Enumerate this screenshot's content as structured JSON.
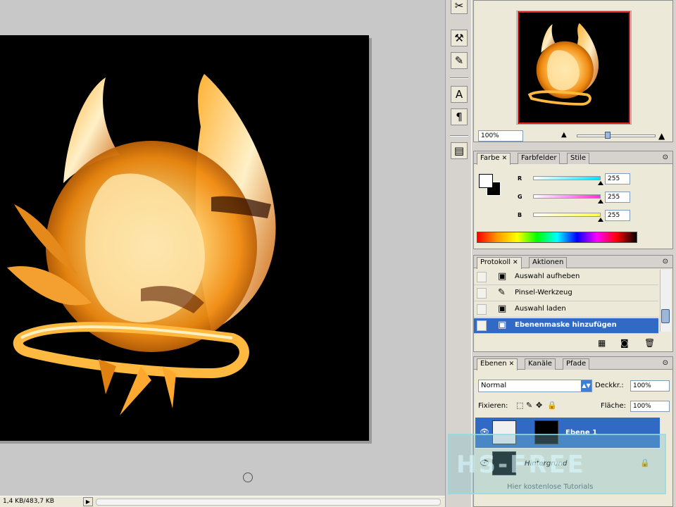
{
  "status_bar": {
    "doc_size": "1,4 KB/483,7 KB",
    "arrow": "▶"
  },
  "navigator": {
    "zoom": "100%"
  },
  "color": {
    "tabs": [
      "Farbe",
      "Farbfelder",
      "Stile"
    ],
    "channels": [
      {
        "label": "R",
        "value": "255",
        "gradient": "#00e5ff"
      },
      {
        "label": "G",
        "value": "255",
        "gradient": "#ff30e0"
      },
      {
        "label": "B",
        "value": "255",
        "gradient": "#ffff40"
      }
    ],
    "fg_color": "#ffffff",
    "bg_color": "#000000"
  },
  "history": {
    "tabs": [
      "Protokoll",
      "Aktionen"
    ],
    "items": [
      {
        "label": "Auswahl aufheben",
        "icon": "history-state-icon"
      },
      {
        "label": "Pinsel-Werkzeug",
        "icon": "brush-icon"
      },
      {
        "label": "Auswahl laden",
        "icon": "history-state-icon"
      },
      {
        "label": "Ebenenmaske hinzufügen",
        "icon": "history-state-icon",
        "selected": true
      }
    ]
  },
  "layers": {
    "tabs": [
      "Ebenen",
      "Kanäle",
      "Pfade"
    ],
    "blend_mode": "Normal",
    "opacity_label": "Deckkr.:",
    "opacity": "100%",
    "lock_label": "Fixieren:",
    "fill_label": "Fläche:",
    "fill": "100%",
    "layer_rows": [
      {
        "name": "Ebene 1",
        "selected": true
      },
      {
        "name": "Hintergrund",
        "selected": false
      }
    ]
  },
  "watermark": {
    "title": "HS-FREE",
    "subtitle": "Hier kostenlose Tutorials"
  },
  "colors": {
    "selection": "#316ac5",
    "panel_bg": "#ece9d8",
    "nav_frame": "#e02020"
  }
}
